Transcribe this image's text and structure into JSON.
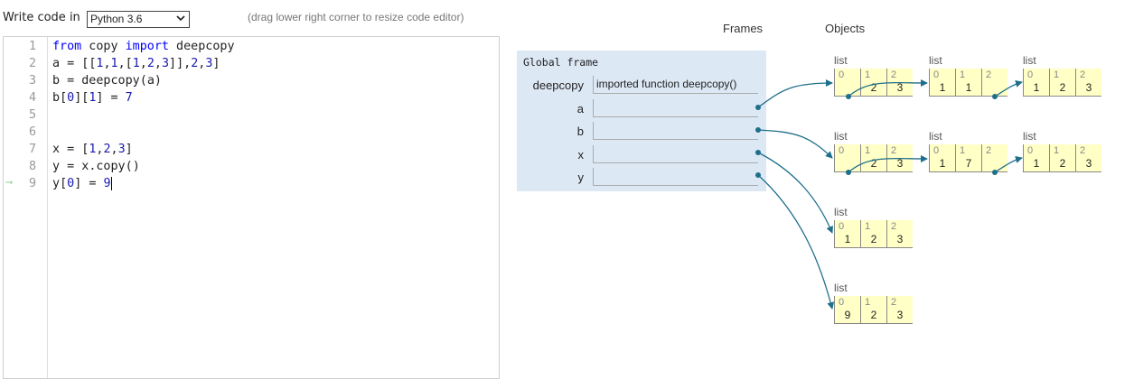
{
  "toolbar": {
    "write_code_label": "Write code in",
    "language_value": "Python 3.6",
    "resize_hint": "(drag lower right corner to resize code editor)"
  },
  "editor": {
    "lines": [
      {
        "num": "1",
        "text": "from copy import deepcopy"
      },
      {
        "num": "2",
        "text": "a = [[1,1,[1,2,3]],2,3]"
      },
      {
        "num": "3",
        "text": "b = deepcopy(a)"
      },
      {
        "num": "4",
        "text": "b[0][1] = 7"
      },
      {
        "num": "5",
        "text": ""
      },
      {
        "num": "6",
        "text": ""
      },
      {
        "num": "7",
        "text": "x = [1,2,3]"
      },
      {
        "num": "8",
        "text": "y = x.copy()"
      },
      {
        "num": "9",
        "text": "y[0] = 9"
      }
    ],
    "current_line": "9"
  },
  "viz": {
    "frames_heading": "Frames",
    "objects_heading": "Objects",
    "global_frame_title": "Global frame",
    "variables": [
      {
        "name": "deepcopy",
        "value": "imported function deepcopy()"
      },
      {
        "name": "a",
        "value": ""
      },
      {
        "name": "b",
        "value": ""
      },
      {
        "name": "x",
        "value": ""
      },
      {
        "name": "y",
        "value": ""
      }
    ],
    "lists": [
      {
        "label": "list",
        "items": [
          {
            "idx": "0",
            "val": ""
          },
          {
            "idx": "1",
            "val": "2"
          },
          {
            "idx": "2",
            "val": "3"
          }
        ]
      },
      {
        "label": "list",
        "items": [
          {
            "idx": "0",
            "val": "1"
          },
          {
            "idx": "1",
            "val": "1"
          },
          {
            "idx": "2",
            "val": ""
          }
        ]
      },
      {
        "label": "list",
        "items": [
          {
            "idx": "0",
            "val": "1"
          },
          {
            "idx": "1",
            "val": "2"
          },
          {
            "idx": "2",
            "val": "3"
          }
        ]
      },
      {
        "label": "list",
        "items": [
          {
            "idx": "0",
            "val": ""
          },
          {
            "idx": "1",
            "val": "2"
          },
          {
            "idx": "2",
            "val": "3"
          }
        ]
      },
      {
        "label": "list",
        "items": [
          {
            "idx": "0",
            "val": "1"
          },
          {
            "idx": "1",
            "val": "7"
          },
          {
            "idx": "2",
            "val": ""
          }
        ]
      },
      {
        "label": "list",
        "items": [
          {
            "idx": "0",
            "val": "1"
          },
          {
            "idx": "1",
            "val": "2"
          },
          {
            "idx": "2",
            "val": "3"
          }
        ]
      },
      {
        "label": "list",
        "items": [
          {
            "idx": "0",
            "val": "1"
          },
          {
            "idx": "1",
            "val": "2"
          },
          {
            "idx": "2",
            "val": "3"
          }
        ]
      },
      {
        "label": "list",
        "items": [
          {
            "idx": "0",
            "val": "9"
          },
          {
            "idx": "1",
            "val": "2"
          },
          {
            "idx": "2",
            "val": "3"
          }
        ]
      }
    ]
  },
  "colors": {
    "arrow": "#1f6f8b",
    "frame_bg": "#dde8f5",
    "cell_bg": "#ffffc6",
    "current_line_arrow": "#9fd39f"
  }
}
